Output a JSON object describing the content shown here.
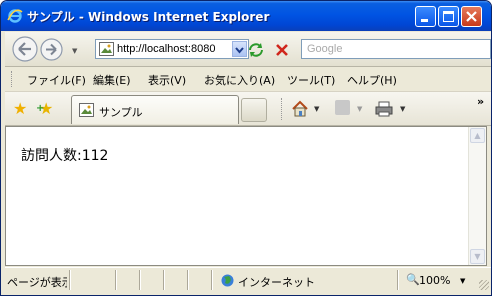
{
  "window": {
    "title": "サンプル - Windows Internet Explorer",
    "buttons": [
      "minimize",
      "maximize",
      "close"
    ]
  },
  "navbar": {
    "address": "http://localhost:8080",
    "search_placeholder": "Google"
  },
  "menubar": {
    "items": [
      "ファイル(F)",
      "編集(E)",
      "表示(V)",
      "お気に入り(A)",
      "ツール(T)",
      "ヘルプ(H)"
    ]
  },
  "favbar": {
    "tab_title": "サンプル"
  },
  "content": {
    "visitor_text": "訪問人数:112"
  },
  "status": {
    "text": "ページが表示されました",
    "zone": "インターネット",
    "zoom": "100%"
  },
  "colors": {
    "titlebar": "#0054e3",
    "chrome": "#ece9d8"
  }
}
